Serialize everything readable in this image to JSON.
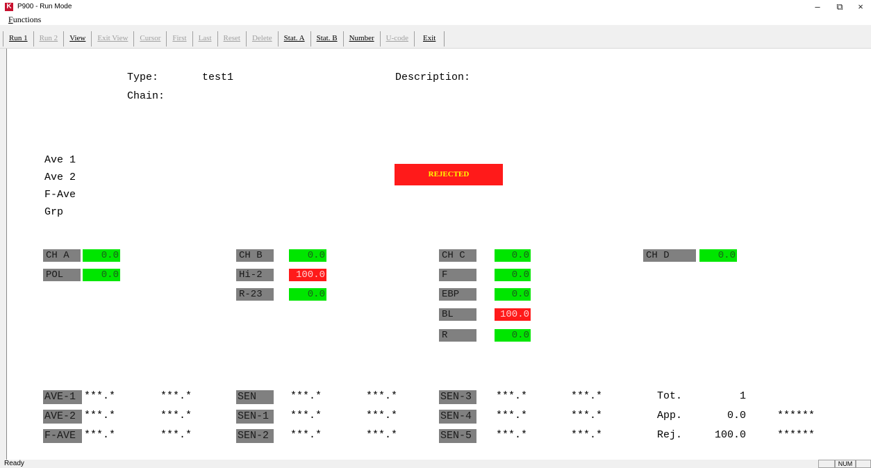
{
  "window": {
    "title": "P900 - Run Mode",
    "icon": "K",
    "controls": {
      "minimize": "–",
      "maximize": "⧉",
      "close": "×"
    }
  },
  "menu": {
    "functions": "Functions"
  },
  "toolbar": {
    "run1": "Run 1",
    "run2": "Run 2",
    "view": "View",
    "exit_view": "Exit View",
    "cursor": "Cursor",
    "first": "First",
    "last": "Last",
    "reset": "Reset",
    "delete": "Delete",
    "stat_a": "Stat. A",
    "stat_b": "Stat. B",
    "number": "Number",
    "ucode": "U-code",
    "exit": "Exit"
  },
  "header": {
    "type_label": "Type:",
    "type_value": "test1",
    "chain_label": "Chain:",
    "description_label": "Description:"
  },
  "averages": {
    "ave1": "Ave 1",
    "ave2": "Ave 2",
    "fave": "F-Ave",
    "grp": "Grp"
  },
  "status_banner": "REJECTED",
  "channels": {
    "cha": {
      "label": "CH A",
      "value": "0.0"
    },
    "pol": {
      "label": "POL",
      "value": "0.0"
    },
    "chb": {
      "label": "CH B",
      "value": "0.0"
    },
    "hi2": {
      "label": "Hi-2",
      "value": "100.0"
    },
    "r23": {
      "label": "R-23",
      "value": "0.0"
    },
    "chc": {
      "label": "CH C",
      "value": "0.0"
    },
    "f": {
      "label": "F",
      "value": "0.0"
    },
    "ebp": {
      "label": "EBP",
      "value": "0.0"
    },
    "bl": {
      "label": "BL",
      "value": "100.0"
    },
    "r": {
      "label": "R",
      "value": "0.0"
    },
    "chd": {
      "label": "CH D",
      "value": "0.0"
    }
  },
  "stats": {
    "ave1": {
      "label": "AVE-1",
      "v1": "***.*",
      "v2": "***.*"
    },
    "ave2": {
      "label": "AVE-2",
      "v1": "***.*",
      "v2": "***.*"
    },
    "fave": {
      "label": "F-AVE",
      "v1": "***.*",
      "v2": "***.*"
    },
    "sen": {
      "label": "SEN",
      "v1": "***.*",
      "v2": "***.*"
    },
    "sen1": {
      "label": "SEN-1",
      "v1": "***.*",
      "v2": "***.*"
    },
    "sen2": {
      "label": "SEN-2",
      "v1": "***.*",
      "v2": "***.*"
    },
    "sen3": {
      "label": "SEN-3",
      "v1": "***.*",
      "v2": "***.*"
    },
    "sen4": {
      "label": "SEN-4",
      "v1": "***.*",
      "v2": "***.*"
    },
    "sen5": {
      "label": "SEN-5",
      "v1": "***.*",
      "v2": "***.*"
    }
  },
  "totals": {
    "tot": {
      "label": "Tot.",
      "value": "1"
    },
    "app": {
      "label": "App.",
      "value": "0.0",
      "extra": "******"
    },
    "rej": {
      "label": "Rej.",
      "value": "100.0",
      "extra": "******"
    }
  },
  "statusbar": {
    "text": "Ready",
    "num": "NUM"
  },
  "colors": {
    "ok": "#00e600",
    "bad": "#ff1a1a",
    "label_bg": "#808080",
    "banner_text": "#ffff00"
  }
}
